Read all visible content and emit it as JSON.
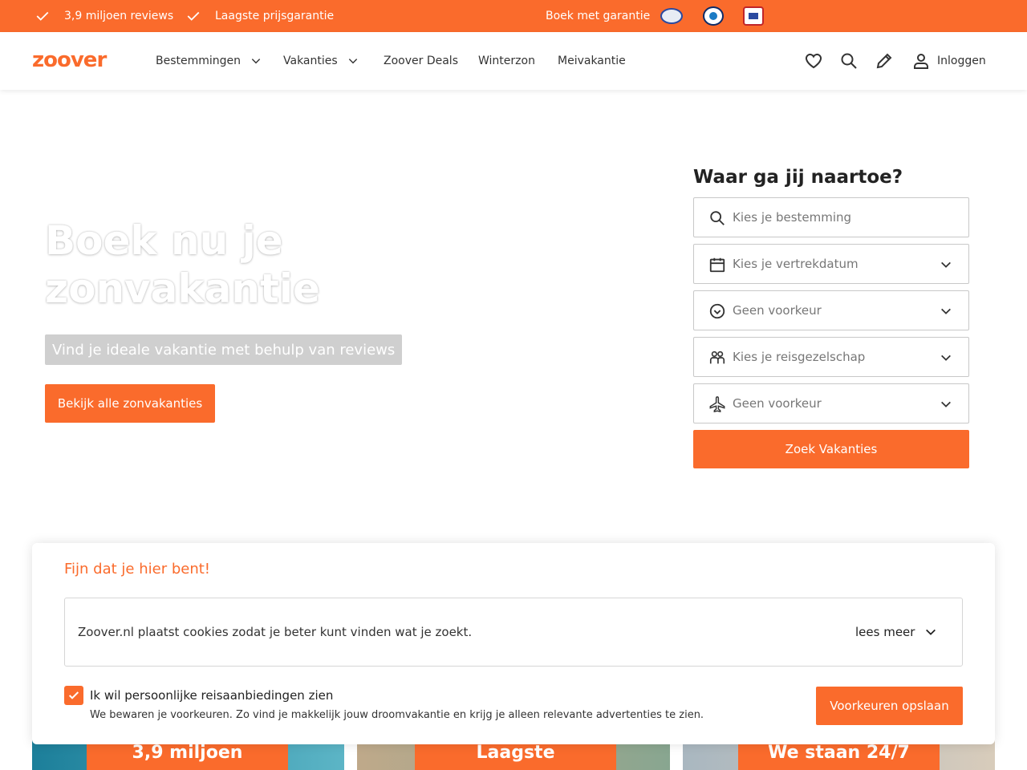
{
  "topbar": {
    "usp1": "3,9 miljoen reviews",
    "usp2": "Laagste prijsgarantie",
    "guarantee": "Boek met garantie",
    "badges": [
      "anvr-logo",
      "sgr-logo",
      "calamiteitenfonds-logo"
    ]
  },
  "header": {
    "logo": "zoover",
    "nav": [
      "Bestemmingen",
      "Vakanties",
      "Zoover Deals",
      "Winterzon",
      "Meivakantie"
    ],
    "login": "Inloggen"
  },
  "hero": {
    "title_line1": "Boek nu je",
    "title_line2": "zonvakantie",
    "subtitle": "Vind je ideale vakantie met behulp van reviews",
    "cta": "Bekijk alle zonvakanties"
  },
  "search": {
    "title": "Waar ga jij naartoe?",
    "destination_placeholder": "Kies je bestemming",
    "date_placeholder": "Kies je vertrekdatum",
    "duration": "Geen voorkeur",
    "travel_party": "Kies je reisgezelschap",
    "departure_airport": "Geen voorkeur",
    "submit": "Zoek Vakanties"
  },
  "promos": [
    "3,9 miljoen",
    "Laagste",
    "We staan 24/7"
  ],
  "cookie": {
    "title": "Fijn dat je hier bent!",
    "text": "Zoover.nl plaatst cookies zodat je beter kunt vinden wat je zoekt.",
    "read_more": "lees meer",
    "checkbox_label": "Ik wil persoonlijke reisaanbiedingen zien",
    "checkbox_desc": "We bewaren je voorkeuren. Zo vind je makkelijk jouw droomvakantie en krijg je alleen relevante advertenties te zien.",
    "checked": true,
    "save": "Voorkeuren opslaan"
  },
  "colors": {
    "accent": "#fa6b2c"
  }
}
